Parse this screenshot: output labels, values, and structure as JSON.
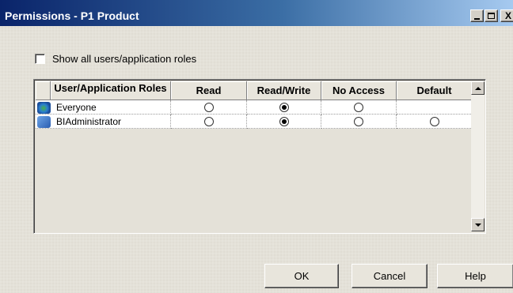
{
  "window": {
    "title": "Permissions - P1  Product",
    "close_glyph": "X"
  },
  "options": {
    "show_all_label": "Show all users/application roles",
    "show_all_checked": false
  },
  "table": {
    "columns": [
      "User/Application Roles",
      "Read",
      "Read/Write",
      "No Access",
      "Default"
    ],
    "rows": [
      {
        "name": "Everyone",
        "icon": "globe-group-icon",
        "read": false,
        "read_write": true,
        "no_access": false,
        "default": null
      },
      {
        "name": "BIAdministrator",
        "icon": "admin-group-icon",
        "read": false,
        "read_write": true,
        "no_access": false,
        "default": false
      }
    ]
  },
  "buttons": {
    "ok": "OK",
    "cancel": "Cancel",
    "help": "Help"
  }
}
